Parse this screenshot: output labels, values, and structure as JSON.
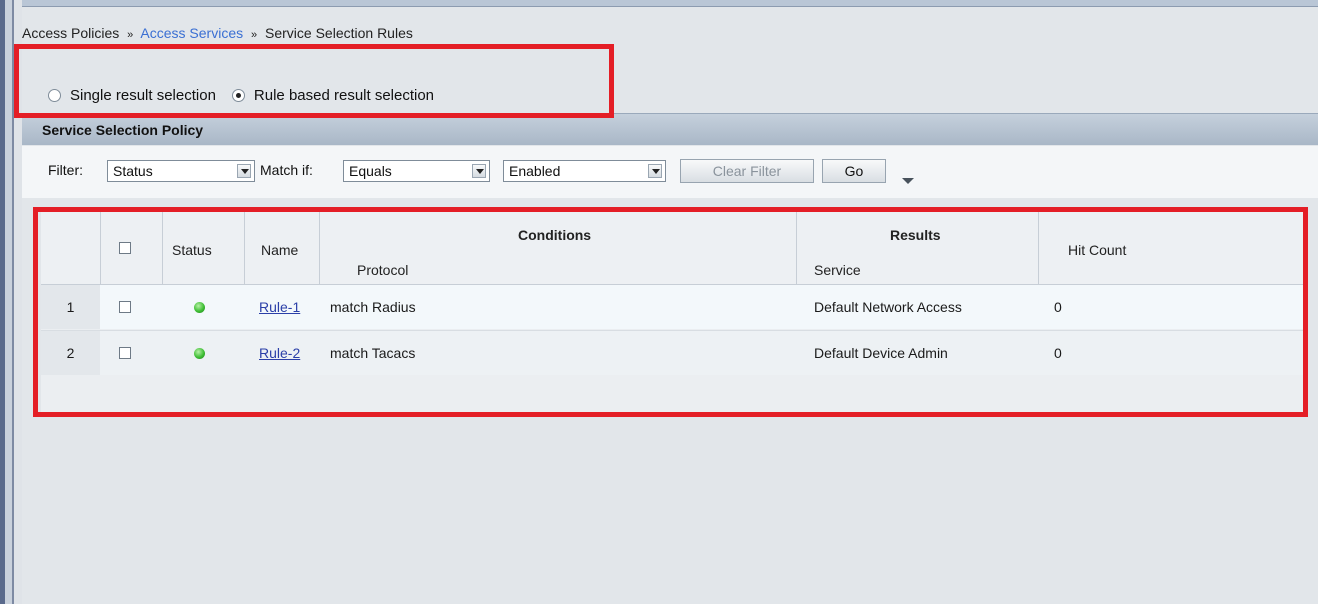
{
  "breadcrumb": {
    "item1": "Access Policies",
    "item2": "Access Services",
    "item3": "Service Selection Rules",
    "separator": "»"
  },
  "selection_mode": {
    "options": [
      {
        "label": "Single result selection",
        "selected": false
      },
      {
        "label": "Rule based result selection",
        "selected": true
      }
    ]
  },
  "policy": {
    "title": "Service Selection Policy"
  },
  "filter": {
    "label": "Filter:",
    "field_value": "Status",
    "match_label": "Match if:",
    "operator_value": "Equals",
    "value": "Enabled",
    "clear_button": "Clear Filter",
    "go_button": "Go"
  },
  "table": {
    "headers": {
      "status": "Status",
      "name": "Name",
      "conditions": "Conditions",
      "protocol": "Protocol",
      "results": "Results",
      "service": "Service",
      "hit_count": "Hit Count"
    },
    "rows": [
      {
        "num": "1",
        "status": "enabled",
        "name": "Rule-1",
        "protocol": "match Radius",
        "service": "Default Network Access",
        "hit_count": "0"
      },
      {
        "num": "2",
        "status": "enabled",
        "name": "Rule-2",
        "protocol": "match Tacacs",
        "service": "Default Device Admin",
        "hit_count": "0"
      }
    ]
  },
  "colors": {
    "highlight": "#e41e26",
    "status_enabled": "#3fbf35",
    "link": "#3a6fd3"
  }
}
